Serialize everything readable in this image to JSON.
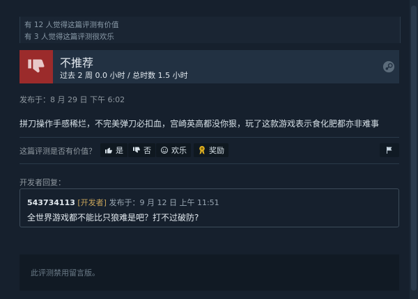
{
  "helpful": {
    "line1": "有 12 人觉得这篇评测有价值",
    "line2": "有 3 人觉得这篇评测很欢乐"
  },
  "verdict": {
    "title": "不推荐",
    "hours": "过去 2 周 0.0 小时 / 总时数 1.5 小时",
    "icon": "thumbs-down-icon",
    "color": "#9b2b2b"
  },
  "posted": "发布于：8 月 29 日 下午 6:02",
  "review_text": "拼刀操作手感稀烂，不完美弹刀必扣血，宫崎英高都没你狠，玩了这款游戏表示食化肥都亦非难事",
  "vote": {
    "question": "这篇评测是否有价值？",
    "yes": "是",
    "no": "否",
    "funny": "欢乐",
    "award": "奖励"
  },
  "developer_response": {
    "label": "开发者回复：",
    "name": "543734113",
    "tag": "[开发者]",
    "posted": "发布于：9 月 12 日 上午 11:51",
    "text": "全世界游戏都不能比只狼难是吧？打不过破防?"
  },
  "comments": {
    "disabled_text": "此评测禁用留言版。"
  }
}
